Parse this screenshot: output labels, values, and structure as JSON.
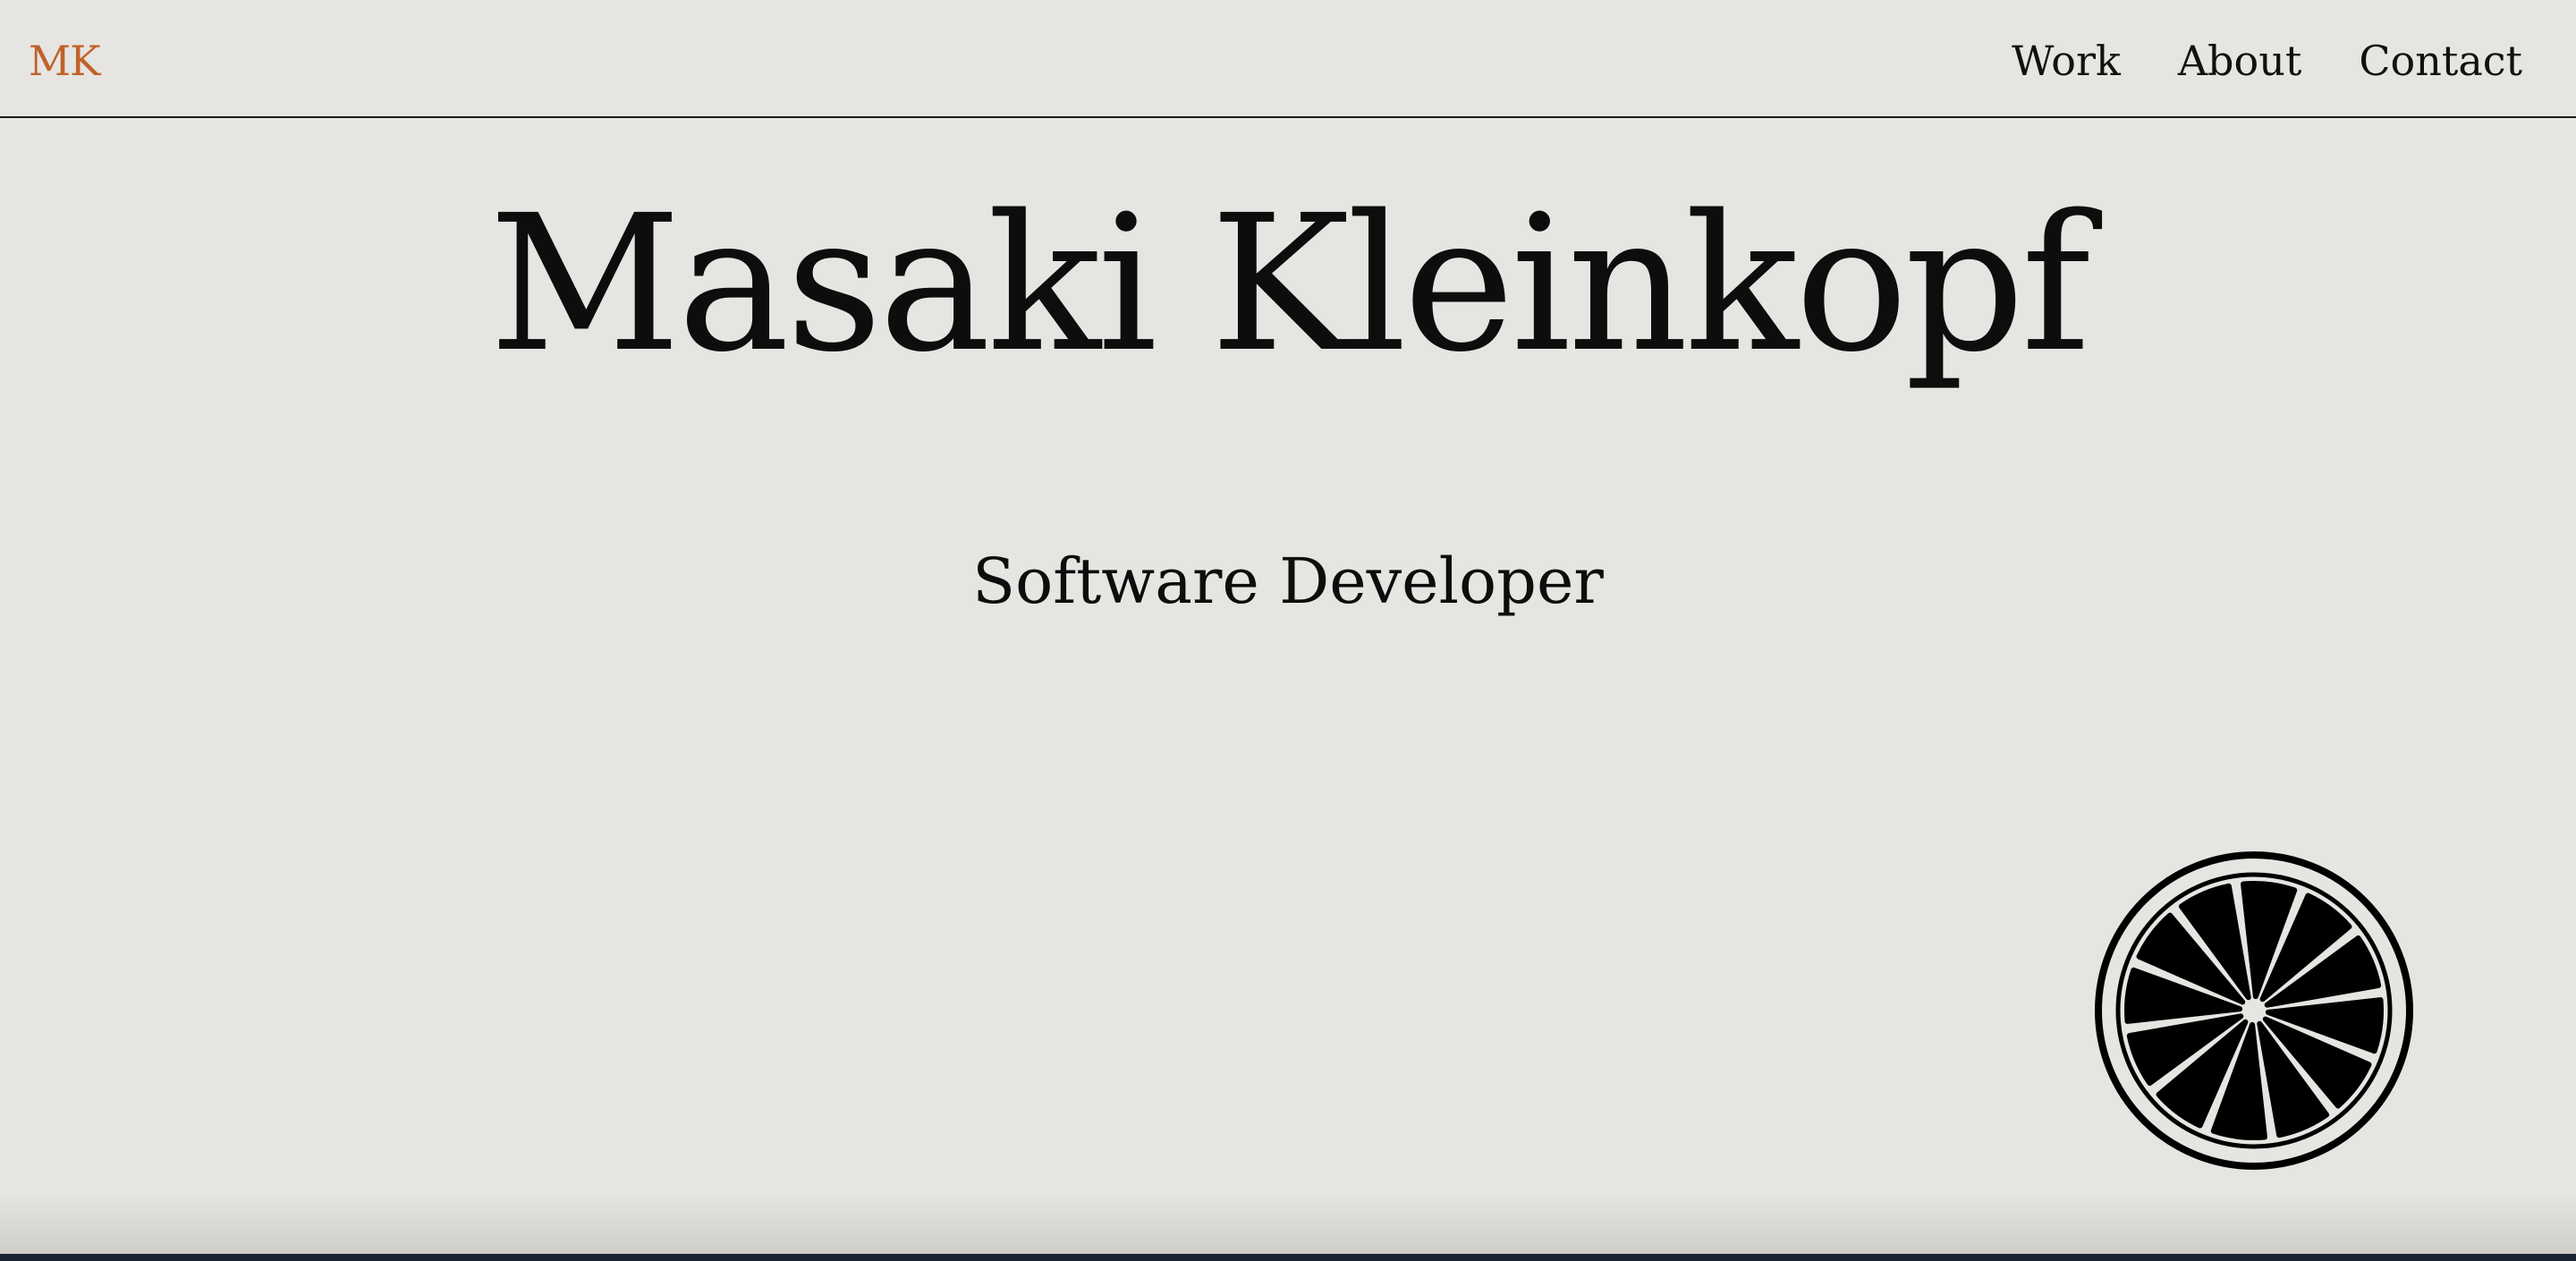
{
  "header": {
    "logo": "MK",
    "nav": [
      {
        "label": "Work"
      },
      {
        "label": "About"
      },
      {
        "label": "Contact"
      }
    ]
  },
  "hero": {
    "name": "Masaki Kleinkopf",
    "role": "Software Developer"
  },
  "decoration": {
    "icon": "citrus-slice-icon"
  },
  "colors": {
    "background": "#e6e5e1",
    "accent": "#c0622b",
    "text": "#0d0d0d"
  }
}
